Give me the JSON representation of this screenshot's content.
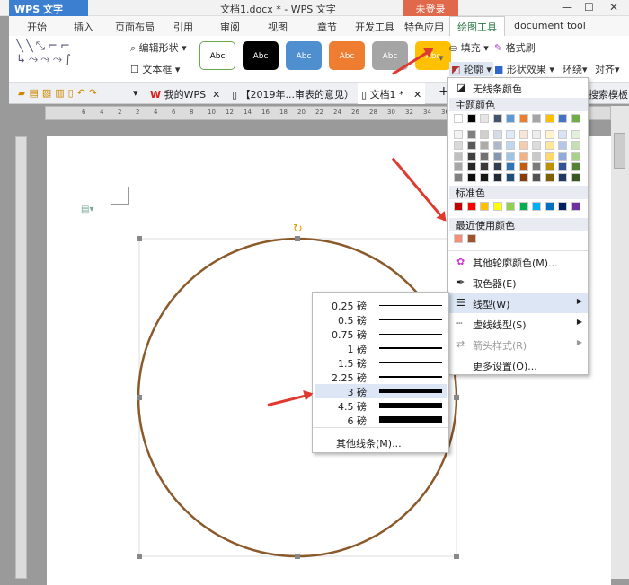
{
  "app": {
    "logo": "WPS 文字",
    "title": "文档1.docx * - WPS 文字",
    "login": "未登录"
  },
  "tabs": [
    "开始",
    "插入",
    "页面布局",
    "引用",
    "审阅",
    "视图",
    "章节",
    "开发工具",
    "特色应用",
    "绘图工具",
    "document tool"
  ],
  "ribbon": {
    "edit_shape": "编辑形状",
    "textbox": "文本框",
    "styles": [
      {
        "label": "Abc",
        "bg": "#ffffff",
        "fg": "#000",
        "border": "#6aa84f"
      },
      {
        "label": "Abc",
        "bg": "#000000",
        "fg": "#fff",
        "border": "#000"
      },
      {
        "label": "Abc",
        "bg": "#4f8fd0",
        "fg": "#fff",
        "border": "#4f8fd0"
      },
      {
        "label": "Abc",
        "bg": "#ee7d31",
        "fg": "#fff",
        "border": "#ee7d31"
      },
      {
        "label": "Abc",
        "bg": "#a5a5a5",
        "fg": "#fff",
        "border": "#a5a5a5"
      },
      {
        "label": "Abc",
        "bg": "#ffc000",
        "fg": "#fff",
        "border": "#ffc000"
      }
    ],
    "fill": "填充",
    "format_painter": "格式刷",
    "outline": "轮廓",
    "shape_effects": "形状效果",
    "wrap": "环绕",
    "align": "对齐"
  },
  "doc_tabs": {
    "my_wps": "我的WPS",
    "doc2": "【2019年...审表的意见）",
    "doc1": "文档1 *",
    "search_template": "搜索模板"
  },
  "outline_menu": {
    "no_line": "无线条颜色",
    "theme_colors": "主题颜色",
    "standard_colors": "标准色",
    "recent_colors": "最近使用颜色",
    "more_colors": "其他轮廓颜色(M)...",
    "eyedropper": "取色器(E)",
    "line_style": "线型(W)",
    "dash_style": "虚线线型(S)",
    "arrow_style": "箭头样式(R)",
    "more_settings": "更多设置(O)...",
    "theme_row": [
      "#ffffff",
      "#000000",
      "#e7e6e6",
      "#44546a",
      "#5b9bd5",
      "#ed7d31",
      "#a5a5a5",
      "#ffc000",
      "#4472c4",
      "#70ad47"
    ],
    "theme_shades": [
      [
        "#f2f2f2",
        "#7f7f7f",
        "#d0cece",
        "#d6dce5",
        "#deebf7",
        "#fbe5d6",
        "#ededed",
        "#fff2cc",
        "#dae3f3",
        "#e2f0d9"
      ],
      [
        "#d9d9d9",
        "#595959",
        "#aeabab",
        "#adb9ca",
        "#bdd7ee",
        "#f8cbad",
        "#dbdbdb",
        "#ffe699",
        "#b4c7e7",
        "#c5e0b4"
      ],
      [
        "#bfbfbf",
        "#404040",
        "#757171",
        "#8497b0",
        "#9dc3e6",
        "#f4b183",
        "#c9c9c9",
        "#ffd966",
        "#8faadc",
        "#a9d18e"
      ],
      [
        "#a6a6a6",
        "#262626",
        "#3a3838",
        "#333f50",
        "#2e75b6",
        "#c55a11",
        "#7b7b7b",
        "#bf9000",
        "#2f5597",
        "#548235"
      ],
      [
        "#808080",
        "#0d0d0d",
        "#171616",
        "#222a35",
        "#1f4e79",
        "#843c0c",
        "#525252",
        "#7f6000",
        "#203864",
        "#385723"
      ]
    ],
    "standard": [
      "#c00000",
      "#ff0000",
      "#ffc000",
      "#ffff00",
      "#92d050",
      "#00b050",
      "#00b0f0",
      "#0070c0",
      "#002060",
      "#7030a0"
    ],
    "recent": [
      "#f4907a",
      "#a0522d"
    ]
  },
  "line_weights": {
    "items": [
      {
        "label": "0.25 磅",
        "pt": 0.25
      },
      {
        "label": "0.5 磅",
        "pt": 0.5
      },
      {
        "label": "0.75 磅",
        "pt": 0.75
      },
      {
        "label": "1 磅",
        "pt": 1
      },
      {
        "label": "1.5 磅",
        "pt": 1.5
      },
      {
        "label": "2.25 磅",
        "pt": 2.25
      },
      {
        "label": "3 磅",
        "pt": 3
      },
      {
        "label": "4.5 磅",
        "pt": 4.5
      },
      {
        "label": "6 磅",
        "pt": 6
      }
    ],
    "selected": "3 磅",
    "more": "其他线条(M)..."
  },
  "shape": {
    "stroke": "#8b5a2b"
  },
  "ruler": [
    "6",
    "4",
    "2",
    "2",
    "4",
    "6",
    "8",
    "10",
    "12",
    "14",
    "16",
    "18",
    "20",
    "22",
    "24",
    "26",
    "28",
    "30",
    "32",
    "34",
    "36"
  ]
}
